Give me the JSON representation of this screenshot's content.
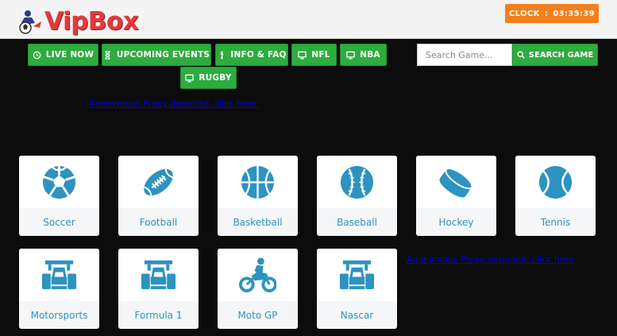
{
  "brand": {
    "name": "VipBox"
  },
  "clock": {
    "label": "CLOCK",
    "separator": ":",
    "time": "03:35:39"
  },
  "nav": [
    {
      "label": "LIVE NOW",
      "icon": "clock-icon"
    },
    {
      "label": "UPCOMING EVENTS",
      "icon": "hourglass-icon"
    },
    {
      "label": "INFO & FAQ",
      "icon": "info-icon"
    },
    {
      "label": "NFL",
      "icon": "monitor-icon"
    },
    {
      "label": "NBA",
      "icon": "monitor-icon"
    },
    {
      "label": "RUGBY",
      "icon": "monitor-icon"
    }
  ],
  "search": {
    "placeholder": "Search Game...",
    "button": "SEARCH GAME"
  },
  "proxy_notice": "Anonymous Proxy detected, click here.",
  "sports": [
    {
      "label": "Soccer",
      "icon": "soccer-ball-icon"
    },
    {
      "label": "Football",
      "icon": "football-icon"
    },
    {
      "label": "Basketball",
      "icon": "basketball-icon"
    },
    {
      "label": "Baseball",
      "icon": "baseball-icon"
    },
    {
      "label": "Hockey",
      "icon": "hockey-puck-icon"
    },
    {
      "label": "Tennis",
      "icon": "tennis-ball-icon"
    },
    {
      "label": "Motorsports",
      "icon": "race-car-icon"
    },
    {
      "label": "Formula 1",
      "icon": "race-car-icon"
    },
    {
      "label": "Moto GP",
      "icon": "motorcycle-icon"
    },
    {
      "label": "Nascar",
      "icon": "race-car-icon"
    }
  ],
  "colors": {
    "accent_green": "#2dac3f",
    "clock_orange": "#f57f1b",
    "icon_blue": "#2d93c0",
    "background": "#0c0c0c"
  }
}
